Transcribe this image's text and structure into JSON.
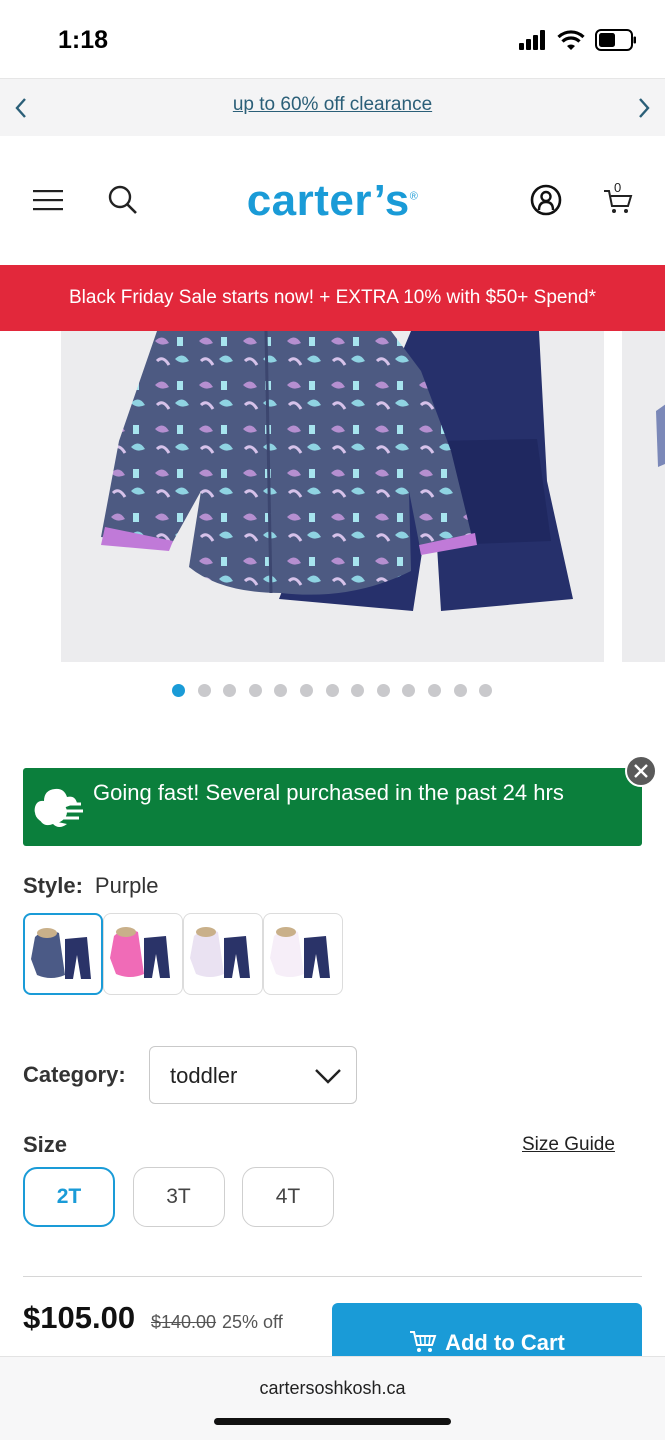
{
  "status": {
    "time": "1:18"
  },
  "promo": {
    "text": "up to 60% off clearance"
  },
  "header": {
    "logo_text": "carter’s",
    "logo_mark": "®",
    "cart_count": "0"
  },
  "sale_banner": {
    "text": "Black Friday Sale starts now! + EXTRA 10% with $50+ Spend*"
  },
  "gallery": {
    "image_count": 13,
    "active_index": 0
  },
  "urgency": {
    "text": "Going fast! Several purchased in the past 24 hrs"
  },
  "style": {
    "label": "Style:",
    "value": "Purple",
    "swatches": [
      {
        "color": "#4b5a86",
        "selected": true
      },
      {
        "color": "#f06bb7",
        "selected": false
      },
      {
        "color": "#eae2f2",
        "selected": false
      },
      {
        "color": "#f6eef8",
        "selected": false
      }
    ]
  },
  "category": {
    "label": "Category:",
    "value": "toddler"
  },
  "size": {
    "label": "Size",
    "guide": "Size Guide",
    "options": [
      {
        "label": "2T",
        "selected": true
      },
      {
        "label": "3T",
        "selected": false
      },
      {
        "label": "4T",
        "selected": false
      }
    ]
  },
  "purchase": {
    "price": "$105.00",
    "original_price": "$140.00",
    "discount": "25% off",
    "add_to_cart": "Add to Cart"
  },
  "browser": {
    "url": "cartersoshkosh.ca"
  },
  "colors": {
    "brand": "#1a9bd7",
    "sale": "#e2283b",
    "urgency": "#0b7f3c"
  }
}
